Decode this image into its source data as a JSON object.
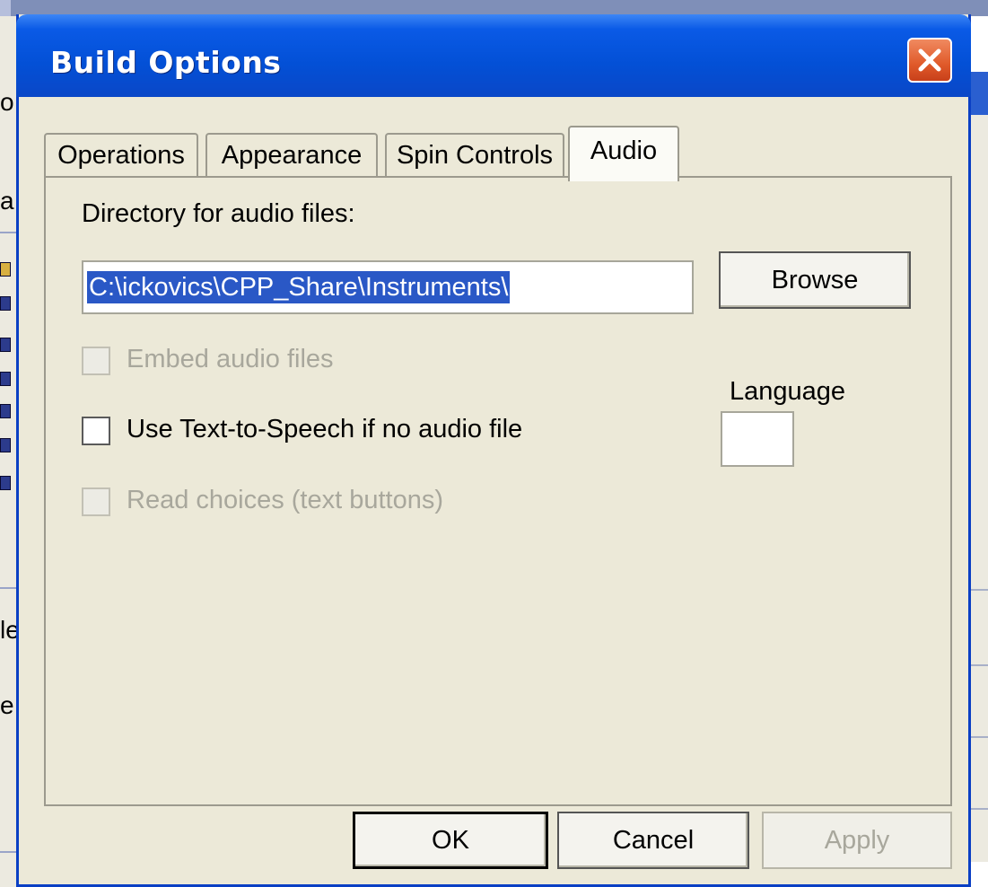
{
  "background": {
    "fragments": [
      "o",
      "a",
      "le",
      "e"
    ]
  },
  "dialog": {
    "title": "Build Options",
    "close_icon": "close-x-icon",
    "tabs": [
      {
        "label": "Operations",
        "active": false
      },
      {
        "label": "Appearance",
        "active": false
      },
      {
        "label": "Spin Controls",
        "active": false
      },
      {
        "label": "Audio",
        "active": true
      }
    ],
    "audio": {
      "directory_label": "Directory for audio files:",
      "directory_value": "C:\\ickovics\\CPP_Share\\Instruments\\",
      "browse_label": "Browse",
      "embed_label": "Embed audio files",
      "embed_checked": false,
      "embed_enabled": false,
      "tts_label": "Use Text-to-Speech if no audio file",
      "tts_checked": false,
      "tts_enabled": true,
      "read_choices_label": "Read choices (text buttons)",
      "read_choices_checked": false,
      "read_choices_enabled": false,
      "language_label": "Language",
      "language_value": ""
    },
    "buttons": {
      "ok": "OK",
      "cancel": "Cancel",
      "apply": "Apply"
    }
  },
  "colors": {
    "titlebar": "#0350d6",
    "dialog_bg": "#ece9d8",
    "selection": "#2a58c6",
    "close_button": "#e05a2a",
    "disabled_text": "#a8a79c"
  }
}
